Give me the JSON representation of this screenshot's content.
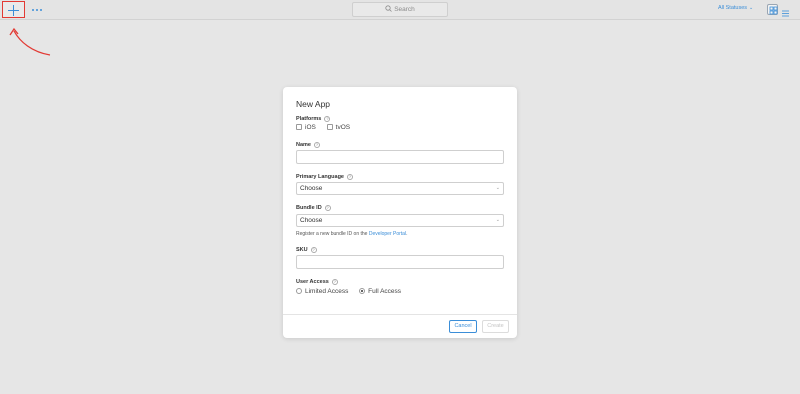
{
  "toolbar": {
    "search_placeholder": "Search",
    "status_filter_label": "All Statuses",
    "add_icon": "plus-icon",
    "more_icon": "ellipsis-icon",
    "grid_icon": "grid-view-icon",
    "list_icon": "list-view-icon",
    "accent_color": "#3b8ed8",
    "highlight_color": "#e23a34"
  },
  "modal": {
    "title": "New App",
    "platforms": {
      "label": "Platforms",
      "options": [
        {
          "label": "iOS",
          "checked": false
        },
        {
          "label": "tvOS",
          "checked": false
        }
      ]
    },
    "name": {
      "label": "Name",
      "value": ""
    },
    "primary_language": {
      "label": "Primary Language",
      "value": "Choose"
    },
    "bundle_id": {
      "label": "Bundle ID",
      "value": "Choose",
      "hint_text": "Register a new bundle ID on the ",
      "hint_link": "Developer Portal",
      "hint_end": "."
    },
    "sku": {
      "label": "SKU",
      "value": ""
    },
    "user_access": {
      "label": "User Access",
      "options": [
        {
          "label": "Limited Access",
          "selected": false
        },
        {
          "label": "Full Access",
          "selected": true
        }
      ]
    },
    "buttons": {
      "cancel": "Cancel",
      "create": "Create"
    },
    "help_glyph": "?"
  }
}
